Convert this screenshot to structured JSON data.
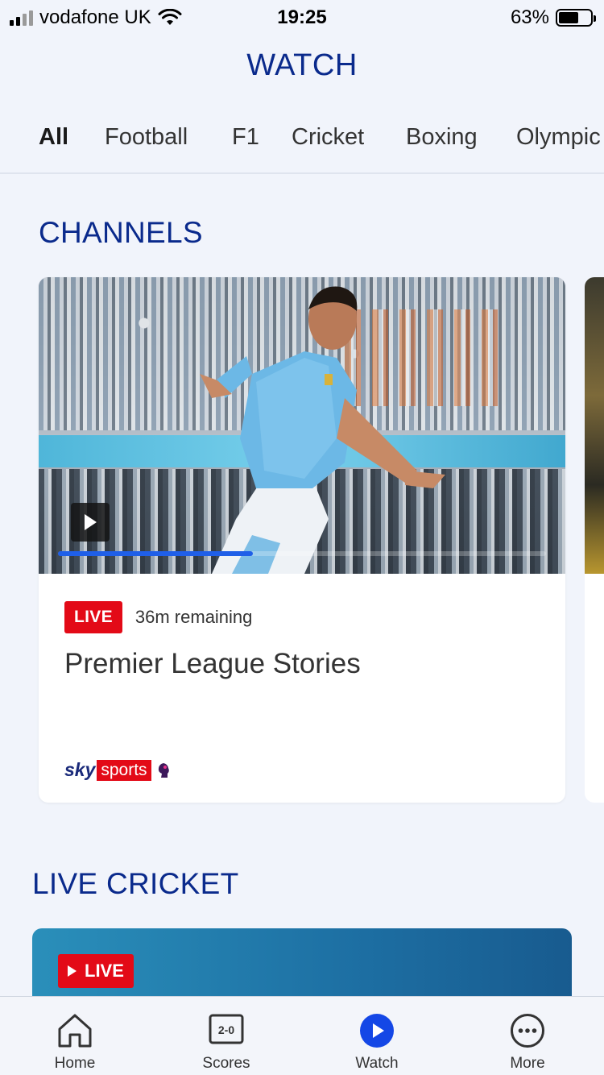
{
  "status_bar": {
    "carrier": "vodafone UK",
    "time": "19:25",
    "battery": "63%",
    "battery_level": 0.63
  },
  "header": {
    "title": "WATCH"
  },
  "tabs": [
    {
      "label": "All",
      "active": true
    },
    {
      "label": "Football"
    },
    {
      "label": "F1"
    },
    {
      "label": "Cricket"
    },
    {
      "label": "Boxing"
    },
    {
      "label": "Olympic"
    }
  ],
  "channels": {
    "title": "CHANNELS",
    "card": {
      "badge": "LIVE",
      "remaining": "36m remaining",
      "title": "Premier League Stories",
      "brand_sky": "sky",
      "brand_sports": "sports",
      "progress": 0.4
    }
  },
  "live_cricket": {
    "title": "LIVE CRICKET",
    "badge": "LIVE"
  },
  "bottom_nav": [
    {
      "label": "Home",
      "icon": "home-icon"
    },
    {
      "label": "Scores",
      "icon": "scores-icon",
      "icon_text": "2-0"
    },
    {
      "label": "Watch",
      "icon": "play-circle-icon",
      "active": true
    },
    {
      "label": "More",
      "icon": "more-icon"
    }
  ],
  "colors": {
    "brand_blue": "#0a2a8c",
    "accent_blue": "#1447e6",
    "live_red": "#e30a17",
    "background": "#f1f4fb"
  }
}
